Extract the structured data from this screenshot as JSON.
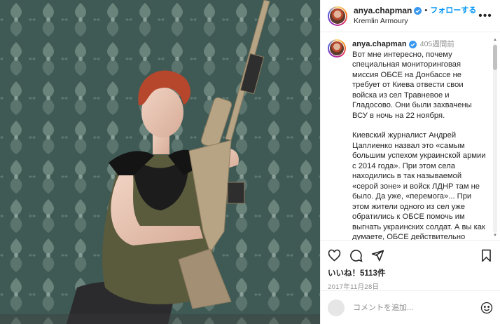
{
  "post": {
    "username": "anya.chapman",
    "follow_label": "フォローする",
    "location": "Kremlin Armoury",
    "caption_time": "405週間前",
    "caption_paragraphs": [
      "Вот мне интересно, почему специальная мониторинговая миссия ОБСЕ на Донбассе не требует от Киева отвести свои войска из сел Травневое и Гладосово. Они были захвачены ВСУ в ночь на 22 ноября.",
      "Киевский журналист Андрей Цаплиенко назвал это «самым большим успехом украинской армии с 2014 года». При этом села находились в так называемой «серой зоне» и войск ЛДНР там не было. Да уже, «перемога»... При этом жители одного из сел уже обратились к ОБСЕ помочь им выгнать украинских солдат. А вы как думаете, ОБСЕ действительно беспристрастно в этом конфликте или «играет» на стороне Украины?"
    ],
    "likes_label": "いいね！5113件",
    "date": "2017年11月28日",
    "comment_placeholder": "コメントを追加..."
  },
  "icons": {
    "verified": "verified-badge-icon",
    "more": "more-options-icon",
    "like": "heart-icon",
    "comment": "comment-icon",
    "share": "share-icon",
    "save": "bookmark-icon",
    "emoji": "emoji-icon"
  },
  "colors": {
    "accent_blue": "#0095f6",
    "verified_blue": "#3897f0",
    "muted_text": "#8e8e8e",
    "wallpaper": "#3f5a55",
    "dress": "#5a5a3c",
    "rifle": "#b7a485"
  }
}
